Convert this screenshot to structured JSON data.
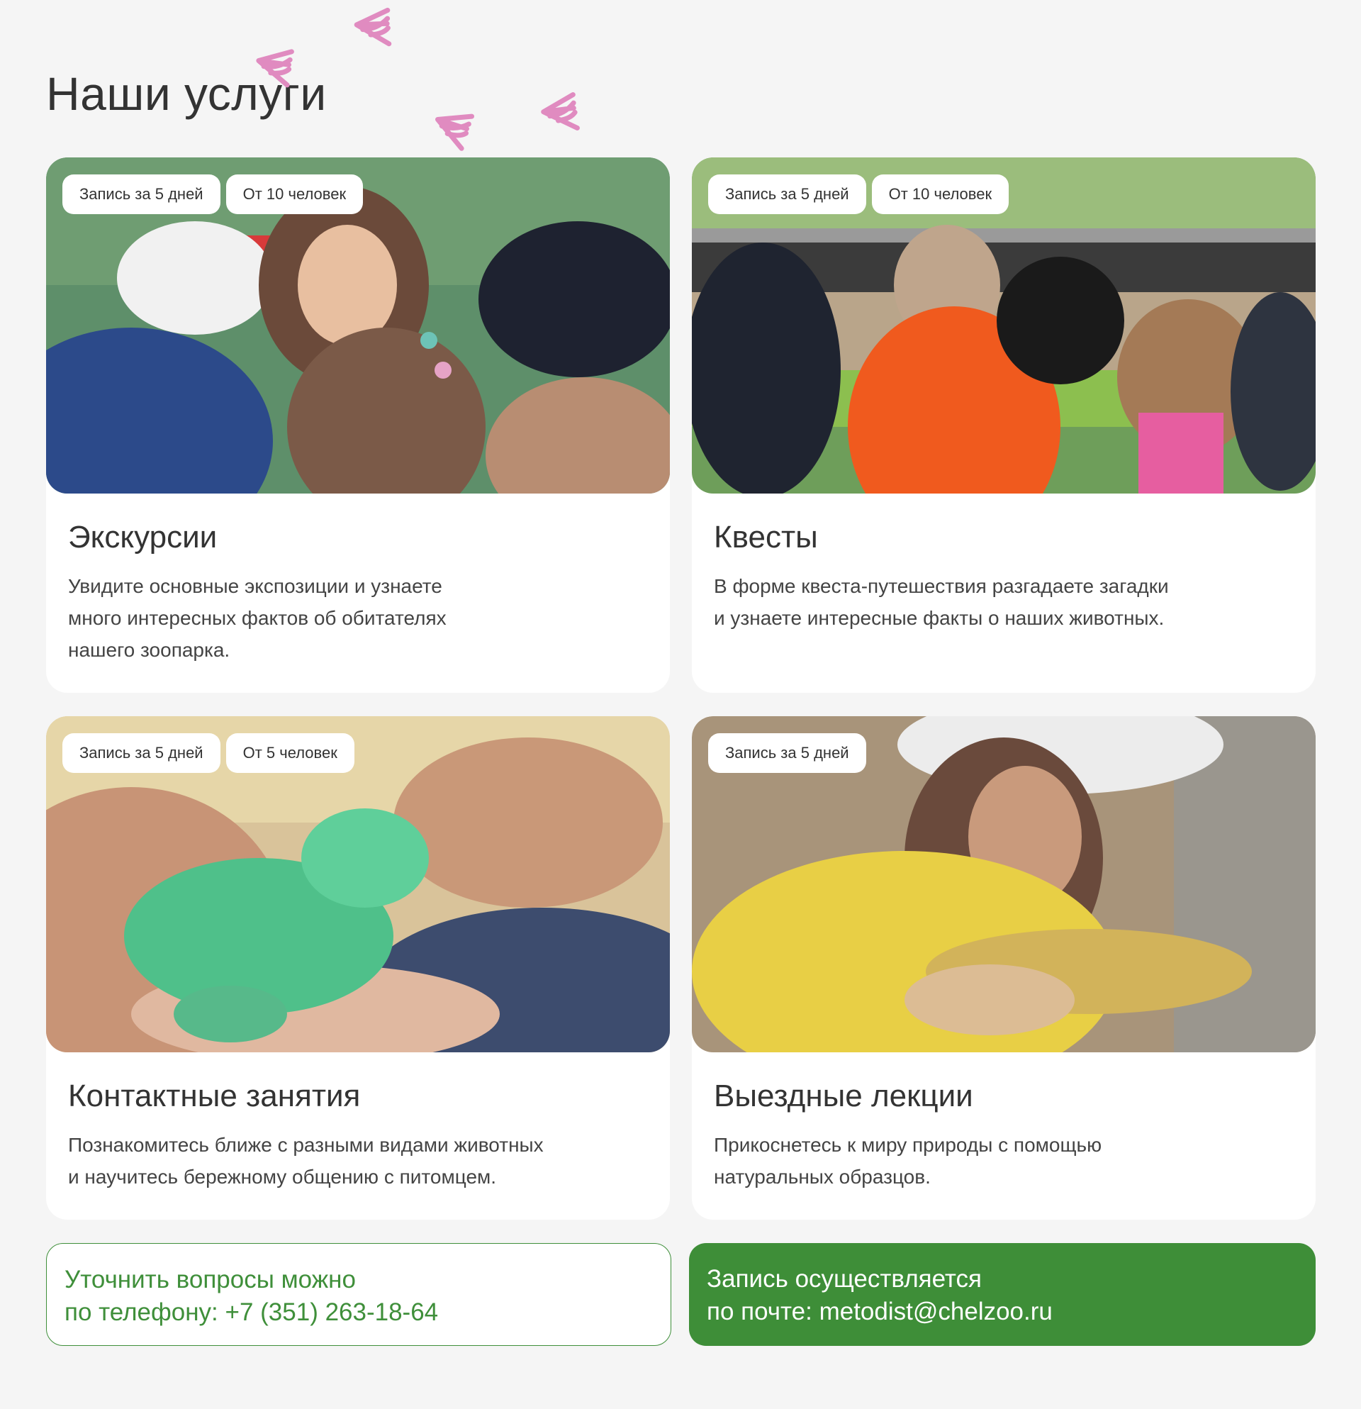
{
  "title": "Наши услуги",
  "accent_color": "#3e8e38",
  "footprint_color": "#e08bc0",
  "cards": [
    {
      "tags": [
        "Запись за 5 дней",
        "От 10 человек"
      ],
      "title": "Экскурсии",
      "text_lines": [
        "Увидите основные экспозиции и узнаете",
        "много интересных фактов об обитателях",
        "нашего зоопарка."
      ]
    },
    {
      "tags": [
        "Запись за 5 дней",
        "От 10 человек"
      ],
      "title": "Квесты",
      "text_lines": [
        "В форме квеста-путешествия разгадаете загадки",
        "и узнаете интересные факты о наших животных."
      ]
    },
    {
      "tags": [
        "Запись за 5 дней",
        "От 5 человек"
      ],
      "title": "Контактные занятия",
      "text_lines": [
        "Познакомитесь ближе с разными видами животных",
        "и научитесь бережному общению с питомцем."
      ]
    },
    {
      "tags": [
        "Запись за 5 дней"
      ],
      "title": "Выездные лекции",
      "text_lines": [
        "Прикоснетесь к миру природы с помощью",
        "натуральных образцов."
      ]
    }
  ],
  "contacts": {
    "phone": {
      "line1": "Уточнить вопросы можно",
      "line2": "по телефону: +7 (351) 263-18-64"
    },
    "email": {
      "line1": "Запись осуществляется",
      "line2": "по почте: metodist@chelzoo.ru"
    }
  }
}
